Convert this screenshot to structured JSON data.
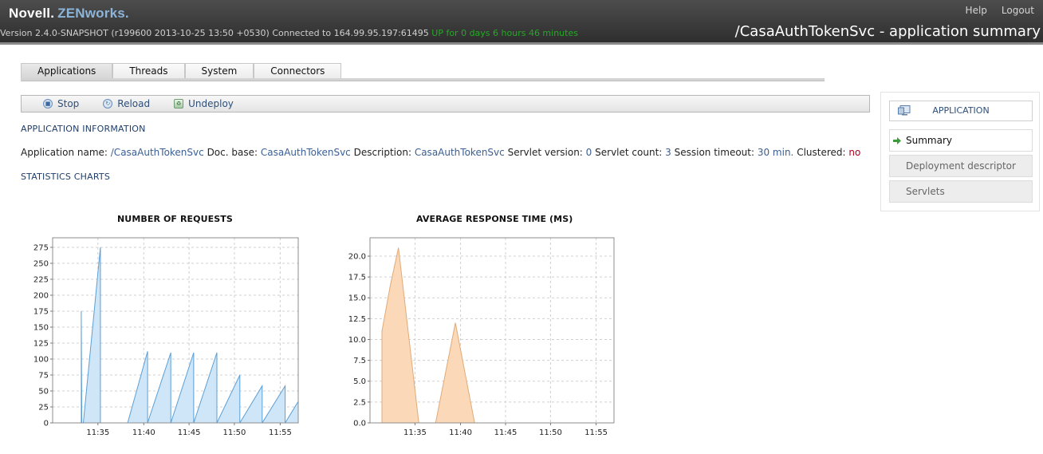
{
  "header": {
    "brand_primary": "Novell.",
    "brand_secondary": "ZENworks.",
    "version_text": "Version 2.4.0-SNAPSHOT (r199600 2013-10-25 13:50 +0530) Connected to 164.99.95.197:61495",
    "uptime_text": "UP for 0 days 6 hours 46 minutes",
    "help_label": "Help",
    "logout_label": "Logout",
    "page_title": "/CasaAuthTokenSvc - application summary"
  },
  "tabs": [
    {
      "label": "Applications",
      "active": true
    },
    {
      "label": "Threads",
      "active": false
    },
    {
      "label": "System",
      "active": false
    },
    {
      "label": "Connectors",
      "active": false
    }
  ],
  "toolbar": {
    "stop_label": "Stop",
    "reload_label": "Reload",
    "undeploy_label": "Undeploy"
  },
  "info": {
    "section_title": "APPLICATION INFORMATION",
    "name_label": "Application name:",
    "name_value": "/CasaAuthTokenSvc",
    "docbase_label": "Doc. base:",
    "docbase_value": "CasaAuthTokenSvc",
    "description_label": "Description:",
    "description_value": "CasaAuthTokenSvc",
    "servlet_version_label": "Servlet version:",
    "servlet_version_value": "0",
    "servlet_count_label": "Servlet count:",
    "servlet_count_value": "3",
    "session_timeout_label": "Session timeout:",
    "session_timeout_value": "30 min.",
    "clustered_label": "Clustered:",
    "clustered_value": "no"
  },
  "charts_section_title": "STATISTICS CHARTS",
  "right_panel": {
    "header_label": "APPLICATION",
    "items": [
      {
        "label": "Summary",
        "selected": true
      },
      {
        "label": "Deployment descriptor",
        "selected": false
      },
      {
        "label": "Servlets",
        "selected": false
      }
    ]
  },
  "colors": {
    "requests_fill": "#cfe6f8",
    "requests_stroke": "#5b9fd6",
    "response_fill": "#fbd9b8",
    "response_stroke": "#e0aa78"
  },
  "chart_data": [
    {
      "type": "area",
      "title": "NUMBER OF REQUESTS",
      "xlabel": "",
      "ylabel": "",
      "x_unit": "minutes",
      "xlim": [
        11.5,
        11.95
      ],
      "ylim": [
        0,
        290
      ],
      "yticks": [
        0,
        25,
        50,
        75,
        100,
        125,
        150,
        175,
        200,
        225,
        250,
        275
      ],
      "xticks": [
        {
          "x": 11.583,
          "label": "11:35"
        },
        {
          "x": 11.667,
          "label": "11:40"
        },
        {
          "x": 11.75,
          "label": "11:45"
        },
        {
          "x": 11.833,
          "label": "11:50"
        },
        {
          "x": 11.917,
          "label": "11:55"
        }
      ],
      "grid": true,
      "series": [
        {
          "points": [
            [
              11.5525,
              0
            ],
            [
              11.5525,
              175
            ],
            [
              11.5535,
              0
            ],
            [
              11.5563,
              0
            ],
            [
              11.5875,
              275
            ],
            [
              11.5875,
              0
            ],
            [
              11.63,
              0
            ],
            [
              11.6375,
              0
            ],
            [
              11.674,
              112
            ],
            [
              11.674,
              0
            ],
            [
              11.7165,
              110
            ],
            [
              11.7165,
              0
            ],
            [
              11.7585,
              110
            ],
            [
              11.7585,
              0
            ],
            [
              11.801,
              110
            ],
            [
              11.801,
              0
            ],
            [
              11.843,
              75
            ],
            [
              11.843,
              0
            ],
            [
              11.884,
              58
            ],
            [
              11.884,
              0
            ],
            [
              11.926,
              58
            ],
            [
              11.926,
              0
            ],
            [
              11.9675,
              58
            ],
            [
              11.9675,
              0
            ],
            [
              12.01,
              58
            ]
          ]
        }
      ]
    },
    {
      "type": "area",
      "title": "AVERAGE RESPONSE TIME (MS)",
      "xlabel": "",
      "ylabel": "",
      "x_unit": "minutes",
      "xlim": [
        11.5,
        11.95
      ],
      "ylim": [
        0,
        22.2
      ],
      "yticks": [
        0.0,
        2.5,
        5.0,
        7.5,
        10.0,
        12.5,
        15.0,
        17.5,
        20.0
      ],
      "ytick_labels": [
        "0.0",
        "2.5",
        "5.0",
        "7.5",
        "10.0",
        "12.5",
        "15.0",
        "17.5",
        "20.0"
      ],
      "xticks": [
        {
          "x": 11.583,
          "label": "11:35"
        },
        {
          "x": 11.667,
          "label": "11:40"
        },
        {
          "x": 11.75,
          "label": "11:45"
        },
        {
          "x": 11.833,
          "label": "11:50"
        },
        {
          "x": 11.917,
          "label": "11:55"
        }
      ],
      "grid": true,
      "series": [
        {
          "points": [
            [
              11.522,
              0
            ],
            [
              11.522,
              11.0
            ],
            [
              11.5375,
              16.5
            ],
            [
              11.5525,
              21.0
            ],
            [
              11.59,
              0
            ],
            [
              11.621,
              0
            ],
            [
              11.6575,
              12.0
            ],
            [
              11.693,
              0
            ]
          ]
        }
      ]
    }
  ]
}
